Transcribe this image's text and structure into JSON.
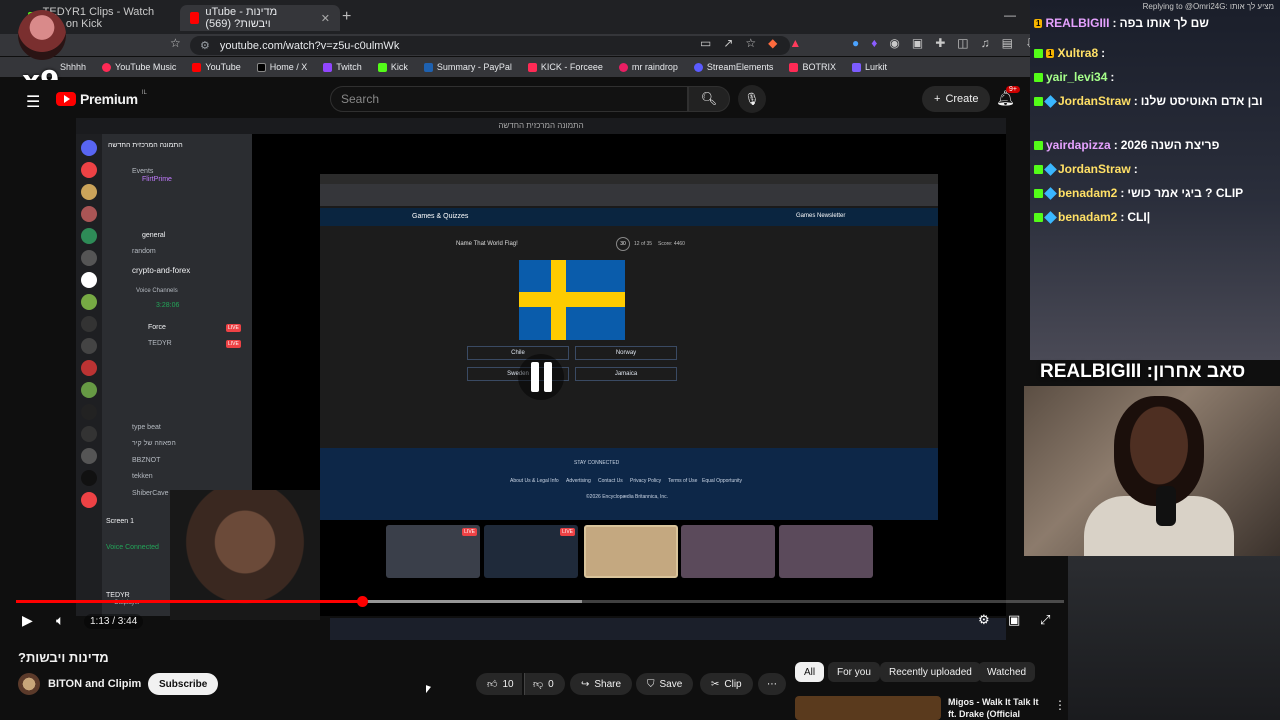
{
  "browser": {
    "tabs": [
      {
        "label": "TEDYR1 Clips - Watch Live on Kick"
      },
      {
        "label": "uTube - מדינות ויבשות? (569)"
      }
    ],
    "url": "youtube.com/watch?v=z5u-c0ulmWk",
    "bookmarks": [
      "Shhhh",
      "YouTube Music",
      "YouTube",
      "Home / X",
      "Twitch",
      "Kick",
      "Summary - PayPal",
      "KICK - Forceee",
      "mr raindrop",
      "StreamElements",
      "BOTRIX",
      "Lurkit"
    ]
  },
  "overlay": {
    "multiplier": "x9"
  },
  "youtube": {
    "brand": "Premium",
    "region": "IL",
    "search_placeholder": "Search",
    "create_label": "Create",
    "notif_count": "9+"
  },
  "video": {
    "window_title": "התמונה המרכזית החדשה",
    "discord": {
      "server_title": "התמונה המרכזית החדשה",
      "channels": [
        "Events",
        "FlirtPrime",
        "general",
        "random",
        "crypto-and-forex",
        "Voice Channels",
        "type beat",
        "הפאוזה של קיר",
        "BBZNOT",
        "tekken",
        "ShiberCave",
        "Screen 1",
        "Voice Connected",
        "TEDYR",
        "Outplayer"
      ],
      "voice_users": [
        "Force",
        "TEDYR"
      ],
      "live_label": "LIVE",
      "timer": "3:28:06"
    },
    "quiz": {
      "header": "Games & Quizzes",
      "newsletter": "Games Newsletter",
      "question": "Name That World Flag!",
      "timer": "30",
      "progress": "12 of 35",
      "score": "Score: 4460",
      "options": [
        "Chile",
        "Norway",
        "Sweden",
        "Jamaica"
      ],
      "footer_links": [
        "About Us & Legal Info",
        "Advertising",
        "Contact Us",
        "Privacy Policy",
        "Terms of Use",
        "Equal Opportunity"
      ],
      "stay_connected": "STAY CONNECTED",
      "copyright": "©2026 Encyclopædia Britannica, Inc."
    },
    "flag_colors": {
      "blue": "#0a5cab",
      "yellow": "#fecb00"
    },
    "progress_fraction": 0.33,
    "buffer_fraction": 0.54,
    "time": "1:13 / 3:44"
  },
  "details": {
    "title": "מדינות ויבשות?",
    "channel": "BITON and Clipim",
    "subscribe": "Subscribe",
    "likes": "10",
    "dislikes": "0",
    "share": "Share",
    "save": "Save",
    "clip": "Clip",
    "chips": [
      "All",
      "For you",
      "Recently uploaded",
      "Watched"
    ],
    "rec_title": "Migos - Walk It Talk It ft. Drake (Official"
  },
  "chat": {
    "reply_to": "Replying to @Omri24G: מציע לך אותו",
    "messages": [
      {
        "user": "REALBIGIII",
        "text": "שם לך אותו בפה"
      },
      {
        "user": "Xultra8",
        "text": ""
      },
      {
        "user": "yair_levi34",
        "text": ""
      },
      {
        "user": "JordanStraw",
        "text": "ובן אדם האוטיסט שלנו"
      },
      {
        "user": "yairdapizza",
        "text": "פריצת השנה 2026"
      },
      {
        "user": "JordanStraw",
        "text": ""
      },
      {
        "user": "benadam2",
        "text": "ביגי אמר כושי ? CLIP"
      },
      {
        "user": "benadam2",
        "text": "CLI|"
      }
    ],
    "last_sub_label": "סאב אחרון: REALBIGIII"
  }
}
